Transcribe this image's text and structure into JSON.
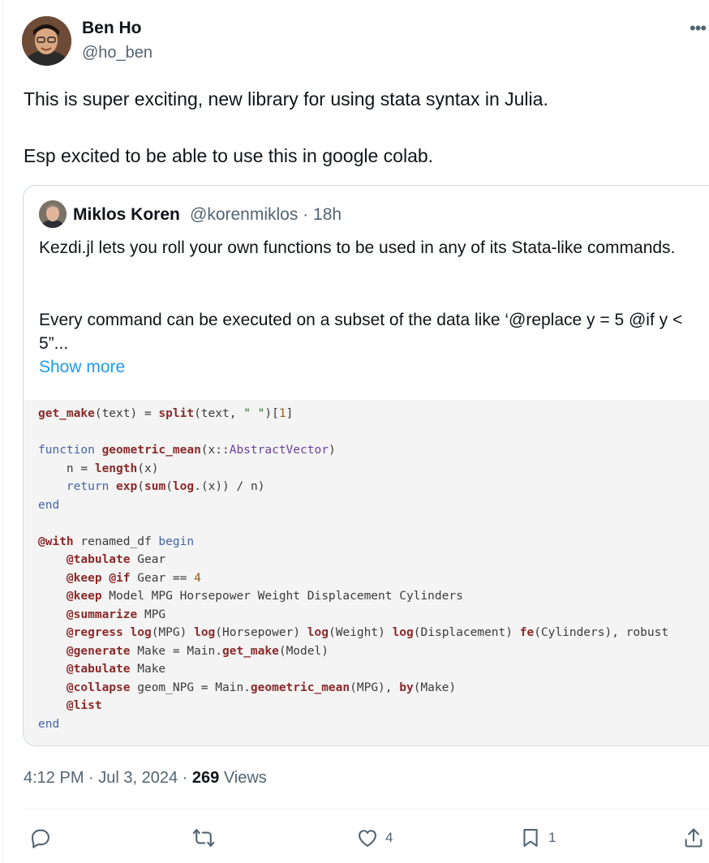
{
  "author": {
    "name": "Ben Ho",
    "handle": "@ho_ben"
  },
  "menu": {
    "icon": "more-horizontal-icon",
    "label": "•••"
  },
  "tweet": {
    "lines": [
      "This is super exciting, new library for using stata syntax in Julia.",
      "Esp excited to be able to use this in google colab."
    ]
  },
  "quote": {
    "name": "Miklos Koren",
    "meta": "@korenmiklos · 18h",
    "text1": "Kezdi.jl lets you roll your own functions to be used in any of its Stata-like commands.",
    "text2": "Every command can be executed on a subset of the data like ‘@replace y = 5 @if y < 5”...",
    "show_more": "Show more",
    "code_lines": [
      "get_make(text) = split(text, \" \")[1]",
      "",
      "function geometric_mean(x::AbstractVector)",
      "    n = length(x)",
      "    return exp(sum(log.(x)) / n)",
      "end",
      "",
      "@with renamed_df begin",
      "    @tabulate Gear",
      "    @keep @if Gear == 4",
      "    @keep Model MPG Horsepower Weight Displacement Cylinders",
      "    @summarize MPG",
      "    @regress log(MPG) log(Horsepower) log(Weight) log(Displacement) fe(Cylinders), robust",
      "    @generate Make = Main.get_make(Model)",
      "    @tabulate Make",
      "    @collapse geom_NPG = Main.geometric_mean(MPG), by(Make)",
      "    @list",
      "end"
    ]
  },
  "meta": {
    "time": "4:12 PM · Jul 3, 2024 · ",
    "views_count": "269",
    "views_label": " Views"
  },
  "actions": {
    "reply": {
      "icon": "reply-icon",
      "count": ""
    },
    "repost": {
      "icon": "repost-icon",
      "count": ""
    },
    "like": {
      "icon": "heart-icon",
      "count": "4"
    },
    "bookmark": {
      "icon": "bookmark-icon",
      "count": "1"
    },
    "share": {
      "icon": "share-icon",
      "count": ""
    }
  },
  "colors": {
    "link": "#1d9bf0",
    "secondary_text": "#536471",
    "code_bg": "#f4f4f4"
  }
}
